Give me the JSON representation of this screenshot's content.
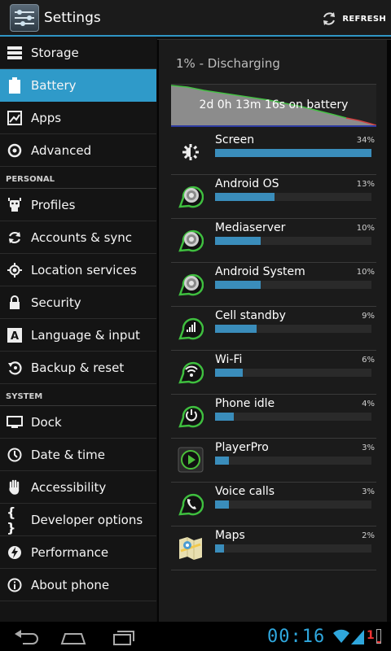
{
  "app": {
    "title": "Settings",
    "refresh_label": "REFRESH"
  },
  "sidebar": {
    "items": [
      {
        "label": "Storage",
        "icon": "storage-icon",
        "active": false
      },
      {
        "label": "Battery",
        "icon": "battery-icon",
        "active": true
      },
      {
        "label": "Apps",
        "icon": "apps-icon",
        "active": false
      },
      {
        "label": "Advanced",
        "icon": "advanced-icon",
        "active": false
      }
    ],
    "personal_header": "PERSONAL",
    "personal_items": [
      {
        "label": "Profiles",
        "icon": "profiles-icon"
      },
      {
        "label": "Accounts & sync",
        "icon": "sync-icon"
      },
      {
        "label": "Location services",
        "icon": "location-icon"
      },
      {
        "label": "Security",
        "icon": "lock-icon"
      },
      {
        "label": "Language & input",
        "icon": "language-icon"
      },
      {
        "label": "Backup & reset",
        "icon": "backup-icon"
      }
    ],
    "system_header": "SYSTEM",
    "system_items": [
      {
        "label": "Dock",
        "icon": "dock-icon"
      },
      {
        "label": "Date & time",
        "icon": "clock-icon"
      },
      {
        "label": "Accessibility",
        "icon": "hand-icon"
      },
      {
        "label": "Developer options",
        "icon": "braces-icon"
      },
      {
        "label": "Performance",
        "icon": "bolt-icon"
      },
      {
        "label": "About phone",
        "icon": "info-icon"
      }
    ]
  },
  "battery": {
    "status": "1% - Discharging",
    "graph_label": "2d 0h 13m 16s on battery",
    "usage": [
      {
        "name": "Screen",
        "percent": "34%",
        "value": 34,
        "icon": "brightness-icon"
      },
      {
        "name": "Android OS",
        "percent": "13%",
        "value": 13,
        "icon": "android-os-icon"
      },
      {
        "name": "Mediaserver",
        "percent": "10%",
        "value": 10,
        "icon": "mediaserver-icon"
      },
      {
        "name": "Android System",
        "percent": "10%",
        "value": 10,
        "icon": "android-system-icon"
      },
      {
        "name": "Cell standby",
        "percent": "9%",
        "value": 9,
        "icon": "cell-signal-icon"
      },
      {
        "name": "Wi-Fi",
        "percent": "6%",
        "value": 6,
        "icon": "wifi-icon"
      },
      {
        "name": "Phone idle",
        "percent": "4%",
        "value": 4,
        "icon": "power-icon"
      },
      {
        "name": "PlayerPro",
        "percent": "3%",
        "value": 3,
        "icon": "playerpro-icon"
      },
      {
        "name": "Voice calls",
        "percent": "3%",
        "value": 3,
        "icon": "phone-icon"
      },
      {
        "name": "Maps",
        "percent": "2%",
        "value": 2,
        "icon": "maps-icon"
      }
    ]
  },
  "statusbar": {
    "time": "00:16",
    "battery_level": "1"
  },
  "colors": {
    "accent": "#2f9ac9",
    "bar_fill": "#3a8dbb",
    "droplet_green": "#3fbf3f"
  }
}
